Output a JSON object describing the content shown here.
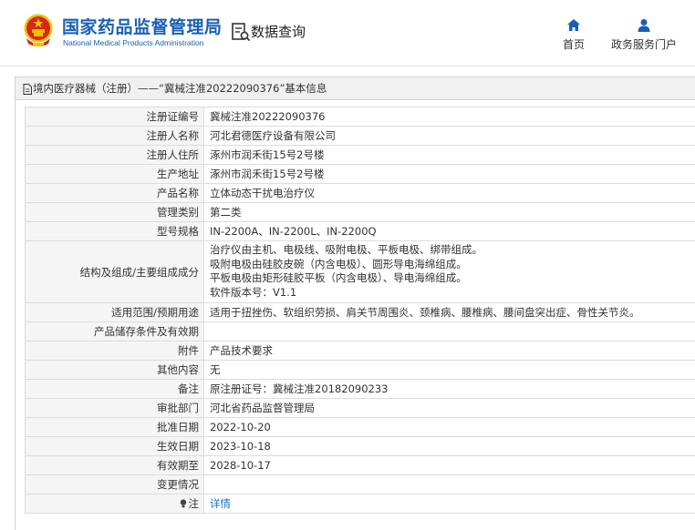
{
  "header": {
    "org_name_cn": "国家药品监督管理局",
    "org_name_en": "National Medical Products Administration",
    "query_title": "数据查询",
    "nav": [
      {
        "label": "首页",
        "icon": "home-icon"
      },
      {
        "label": "政务服务门户",
        "icon": "user-icon"
      }
    ]
  },
  "panel": {
    "title": "境内医疗器械（注册）——“冀械注准20222090376”基本信息"
  },
  "rows": [
    {
      "label": "注册证编号",
      "value": "冀械注准20222090376"
    },
    {
      "label": "注册人名称",
      "value": "河北君德医疗设备有限公司"
    },
    {
      "label": "注册人住所",
      "value": "涿州市润禾街15号2号楼"
    },
    {
      "label": "生产地址",
      "value": "涿州市润禾街15号2号楼"
    },
    {
      "label": "产品名称",
      "value": "立体动态干扰电治疗仪"
    },
    {
      "label": "管理类别",
      "value": "第二类"
    },
    {
      "label": "型号规格",
      "value": "IN-2200A、IN-2200L、IN-2200Q"
    },
    {
      "label": "结构及组成/主要组成成分",
      "lines": [
        "治疗仪由主机、电极线、吸附电极、平板电极、绑带组成。",
        "吸附电极由硅胶皮碗（内含电极）、圆形导电海绵组成。",
        "平板电极由矩形硅胶平板（内含电极）、导电海绵组成。",
        "软件版本号：V1.1"
      ]
    },
    {
      "label": "适用范围/预期用途",
      "value": "适用于扭挫伤、软组织劳损、肩关节周围炎、颈椎病、腰椎病、腰间盘突出症、骨性关节炎。"
    },
    {
      "label": "产品储存条件及有效期",
      "value": ""
    },
    {
      "label": "附件",
      "value": "产品技术要求"
    },
    {
      "label": "其他内容",
      "value": "无"
    },
    {
      "label": "备注",
      "value": "原注册证号：冀械注准20182090233"
    },
    {
      "label": "审批部门",
      "value": "河北省药品监督管理局"
    },
    {
      "label": "批准日期",
      "value": "2022-10-20"
    },
    {
      "label": "生效日期",
      "value": "2023-10-18"
    },
    {
      "label": "有效期至",
      "value": "2028-10-17"
    },
    {
      "label": "变更情况",
      "value": ""
    },
    {
      "label": "注",
      "value": "详情",
      "is_link": true
    }
  ],
  "colors": {
    "brand_blue": "#1a5fb4",
    "link_blue": "#1a6fc4",
    "emblem_red": "#d7261e",
    "emblem_gold": "#f2c200"
  }
}
